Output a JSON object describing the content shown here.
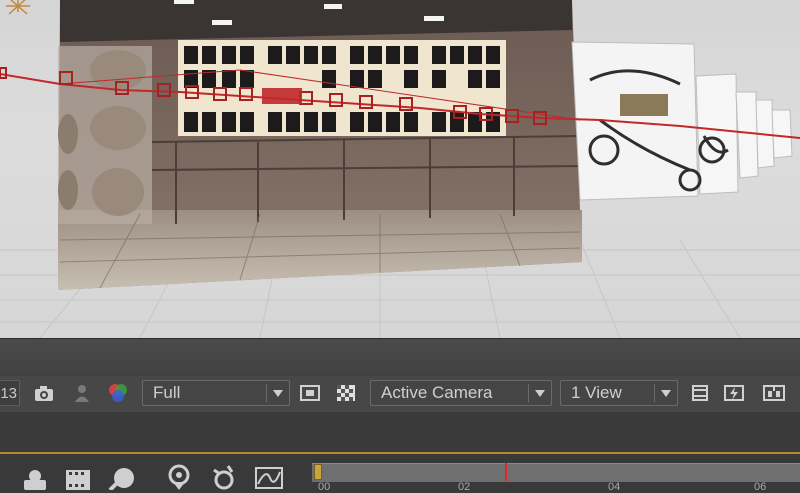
{
  "viewer": {
    "frame_number": "13",
    "resolution": {
      "selected": "Full"
    },
    "camera_view": {
      "selected": "Active Camera"
    },
    "view_layout": {
      "selected": "1 View"
    }
  },
  "icons": {
    "snapshot": "camera-icon",
    "show_snapshot": "person-icon",
    "channels": "rgb-channels-icon",
    "region_of_interest": "region-of-interest-icon",
    "transparency_grid": "transparency-grid-icon",
    "toggle_pixel_aspect": "pixel-aspect-icon",
    "fast_previews": "fast-previews-icon",
    "flowchart": "flowchart-icon",
    "light": "light-icon",
    "camera_tool": "camera-tool-icon",
    "film_strip": "film-strip-icon",
    "shape": "shape-icon",
    "pin": "pin-icon",
    "motion": "motion-icon",
    "graph_editor": "graph-editor-icon"
  },
  "timeline": {
    "ticks": [
      "00",
      "02",
      "04",
      "06"
    ]
  },
  "colors": {
    "motion_path": "#c0282a",
    "playhead": "#e02a2a",
    "work_area": "#c9a43a"
  }
}
